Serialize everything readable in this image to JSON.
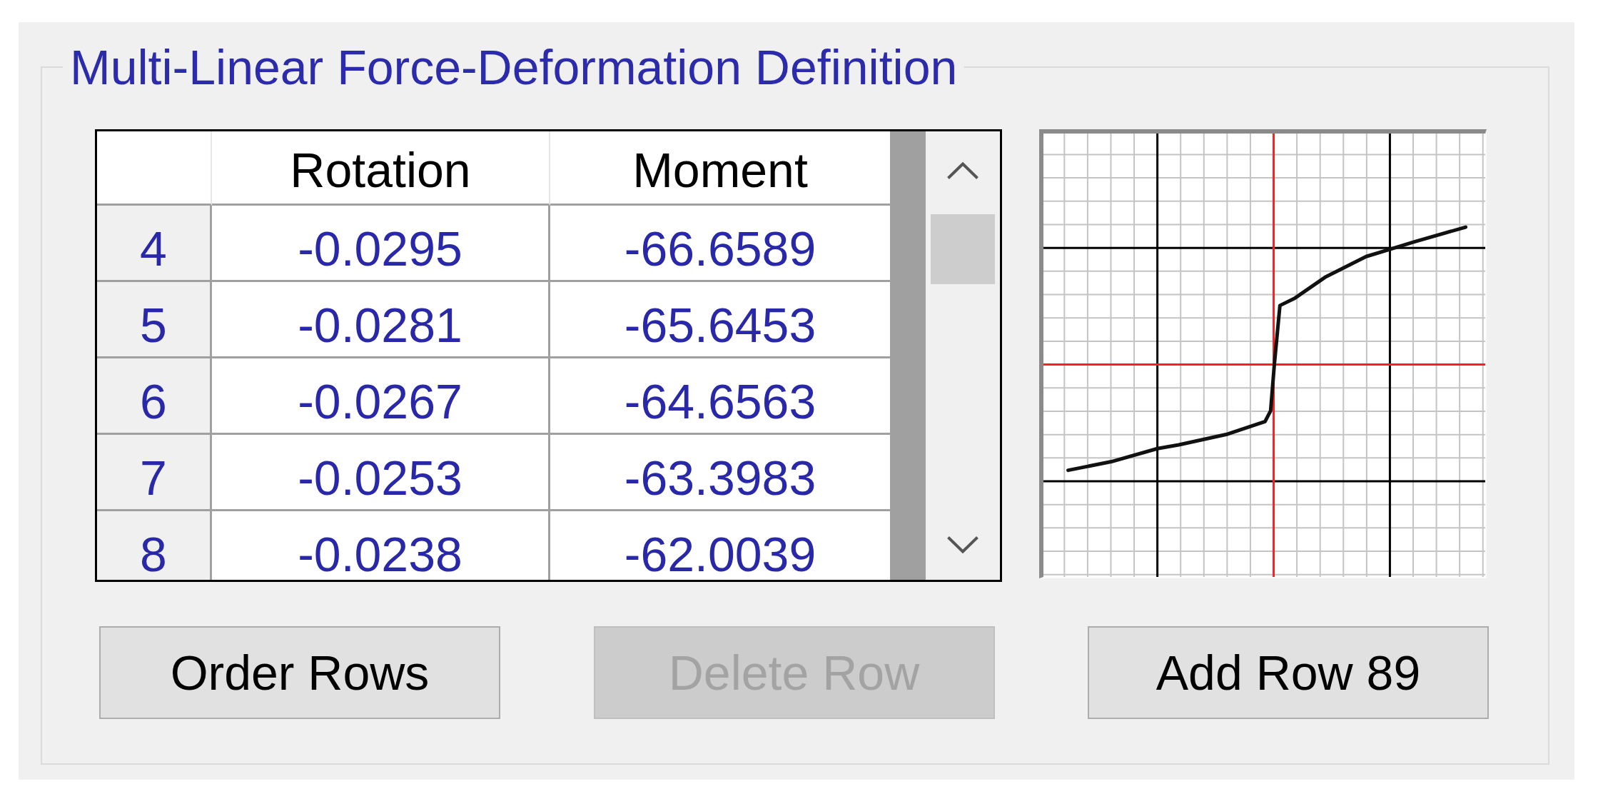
{
  "group_box": {
    "title": "Multi-Linear Force-Deformation Definition"
  },
  "table": {
    "columns": [
      "Rotation",
      "Moment"
    ],
    "rows": [
      {
        "number": "4",
        "cells": [
          "-0.0295",
          "-66.6589"
        ]
      },
      {
        "number": "5",
        "cells": [
          "-0.0281",
          "-65.6453"
        ]
      },
      {
        "number": "6",
        "cells": [
          "-0.0267",
          "-64.6563"
        ]
      },
      {
        "number": "7",
        "cells": [
          "-0.0253",
          "-63.3983"
        ]
      },
      {
        "number": "8",
        "cells": [
          "-0.0238",
          "-62.0039"
        ]
      }
    ]
  },
  "buttons": [
    {
      "label": "Order Rows",
      "disabled": false
    },
    {
      "label": "Delete Row",
      "disabled": true
    },
    {
      "label": "Add Row 89",
      "disabled": false
    }
  ]
}
